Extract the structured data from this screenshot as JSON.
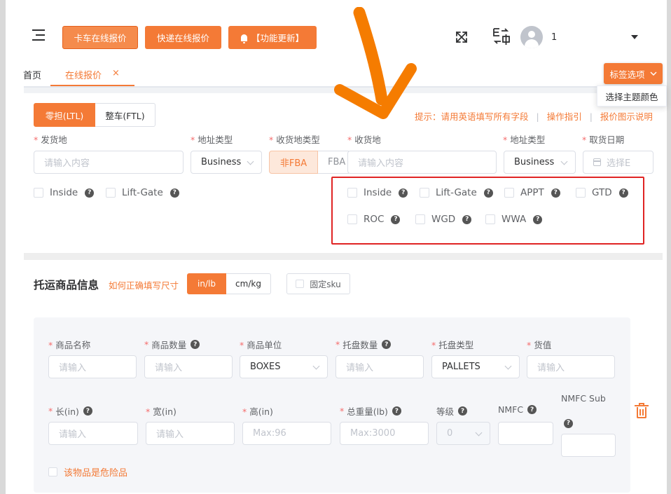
{
  "header": {
    "btn_truck": "卡车在线报价",
    "btn_express": "快递在线报价",
    "btn_update": "【功能更新】",
    "user_name_fragment": "1"
  },
  "tabs": [
    {
      "label": "首页",
      "active": false
    },
    {
      "label": "在线报价",
      "active": true,
      "close": "×"
    }
  ],
  "tag_options": {
    "label": "标签选项",
    "popup_item": "选择主题颜色"
  },
  "mode": {
    "ltl": "零担(LTL)",
    "ftl": "整车(FTL)",
    "selected": "ltl"
  },
  "hints": {
    "tip": "提示：请用英语填写所有字段",
    "guide": "操作指引",
    "quote_help": "报价图示说明",
    "sep": "|"
  },
  "shipping": {
    "origin_label": "发货地",
    "origin_placeholder": "请输入内容",
    "origin_addr_type_label": "地址类型",
    "origin_addr_type_value": "Business",
    "dest_type_label": "收货地类型",
    "dest_type_non_fba": "非FBA",
    "dest_type_fba": "FBA",
    "dest_label": "收货地",
    "dest_placeholder": "请输入内容",
    "dest_addr_type_label": "地址类型",
    "dest_addr_type_value": "Business",
    "pickup_date_label": "取货日期",
    "pickup_date_placeholder": "选择E"
  },
  "origin_services": [
    {
      "label": "Inside",
      "q": "?"
    },
    {
      "label": "Lift-Gate",
      "q": "?"
    }
  ],
  "dest_services": [
    {
      "label": "Inside",
      "q": "?"
    },
    {
      "label": "Lift-Gate",
      "q": "?"
    },
    {
      "label": "APPT",
      "q": "?"
    },
    {
      "label": "GTD",
      "q": "?"
    },
    {
      "label": "ROC",
      "q": "?"
    },
    {
      "label": "WGD",
      "q": "?"
    },
    {
      "label": "WWA",
      "q": "?"
    }
  ],
  "cargo": {
    "title": "托运商品信息",
    "link": "如何正确填写尺寸",
    "unit_inlb": "in/lb",
    "unit_cmkg": "cm/kg",
    "fixed_sku": "固定sku",
    "name_label": "商品名称",
    "qty_label": "商品数量",
    "unit_label": "商品单位",
    "pallet_qty_label": "托盘数量",
    "pallet_type_label": "托盘类型",
    "value_label": "货值",
    "placeholder": "请输入",
    "unit_value": "BOXES",
    "pallet_type_value": "PALLETS",
    "length_label": "长(in)",
    "width_label": "宽(in)",
    "height_label": "高(in)",
    "weight_label": "总重量(lb)",
    "class_label": "等级",
    "nmfc_label": "NMFC",
    "nmfc_sub_label": "NMFC Sub",
    "height_placeholder": "Max:96",
    "weight_placeholder": "Max:3000",
    "class_value": "0",
    "dangerous_label": "该物品是危险品",
    "q": "?"
  },
  "colors": {
    "accent": "#f47a36",
    "annotation_red": "#e02424",
    "annotation_arrow": "#f57c00"
  }
}
